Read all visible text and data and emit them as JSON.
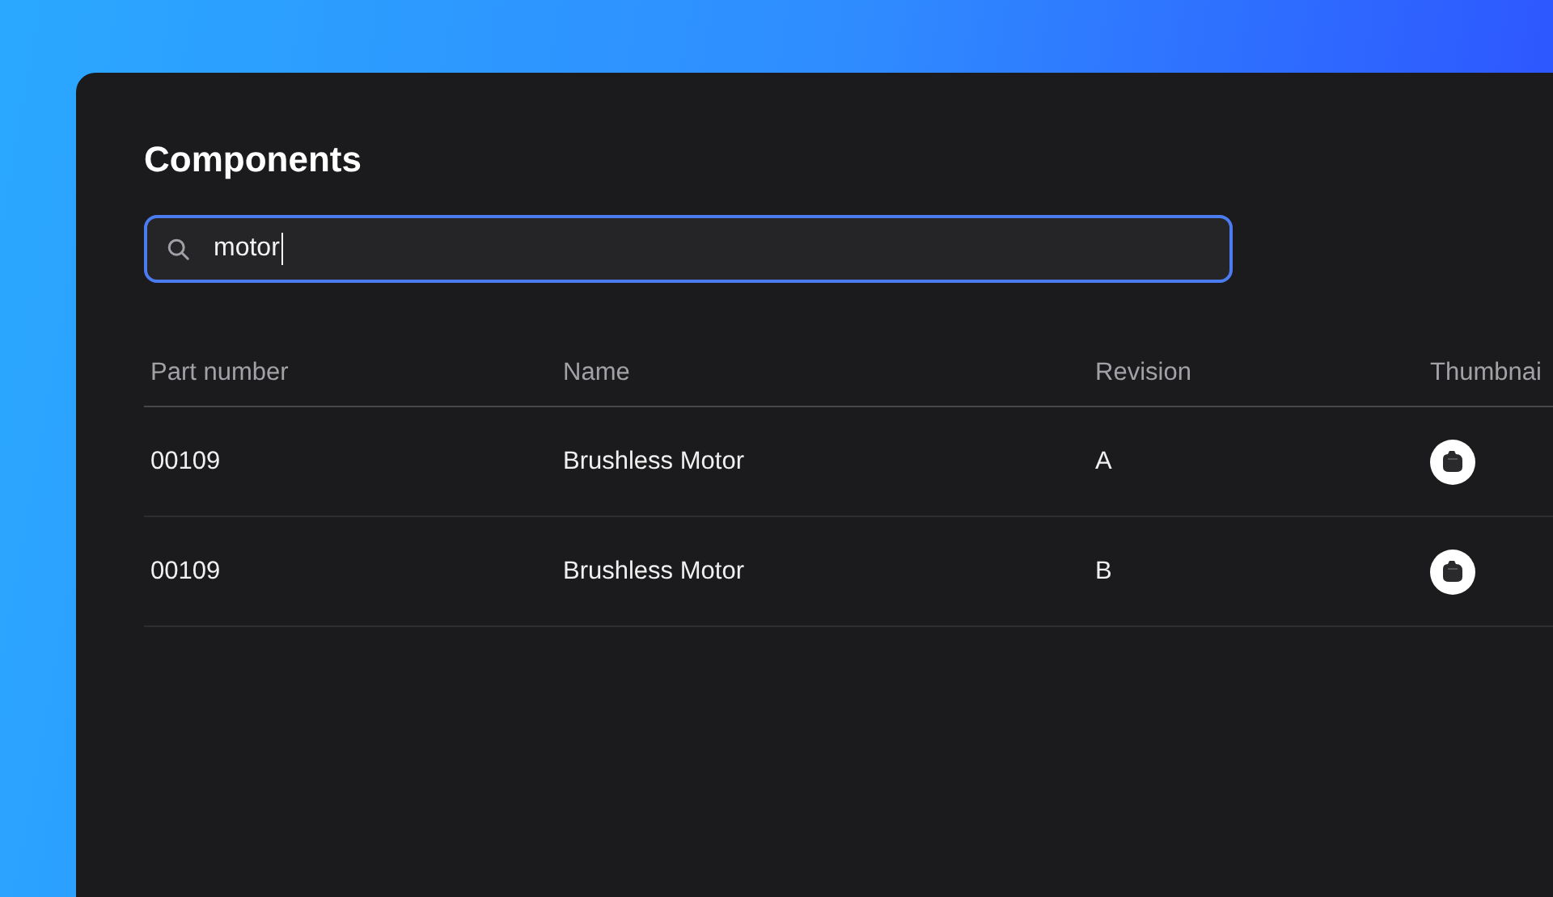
{
  "title": "Components",
  "search": {
    "value": "motor",
    "focused": true
  },
  "table": {
    "columns": [
      "Part number",
      "Name",
      "Revision",
      "Thumbnai"
    ],
    "rows": [
      {
        "part_number": "00109",
        "name": "Brushless Motor",
        "revision": "A"
      },
      {
        "part_number": "00109",
        "name": "Brushless Motor",
        "revision": "B"
      }
    ]
  }
}
